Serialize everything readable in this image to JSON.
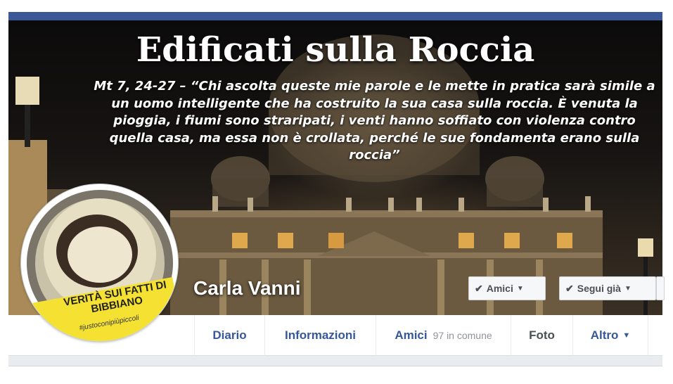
{
  "cover": {
    "title": "Edificati sulla Roccia",
    "quote": "Mt 7, 24-27 –  “Chi ascolta queste mie parole e le mette in pratica sarà simile a un uomo intelligente che ha costruito la sua casa sulla roccia. È venuta la pioggia, i fiumi sono straripati, i venti hanno soffiato con violenza contro quella casa, ma essa non è crollata, perché le sue fondamenta erano sulla roccia”"
  },
  "profile": {
    "name": "Carla Vanni",
    "avatar_text": "VERITÀ SUI FATTI DI BIBBIANO",
    "avatar_hashtag": "#justoconipiùpiccoli"
  },
  "actions": {
    "friends_label": "Amici",
    "follow_label": "Segui già"
  },
  "tabs": {
    "diario": "Diario",
    "informazioni": "Informazioni",
    "amici": "Amici",
    "amici_mutual": "97 in comune",
    "foto": "Foto",
    "altro": "Altro"
  },
  "colors": {
    "header_blue": "#3b5998",
    "link_blue": "#365899",
    "avatar_yellow": "#f5e132"
  },
  "icons": {
    "check": "check-icon",
    "caret": "caret-down-icon"
  }
}
